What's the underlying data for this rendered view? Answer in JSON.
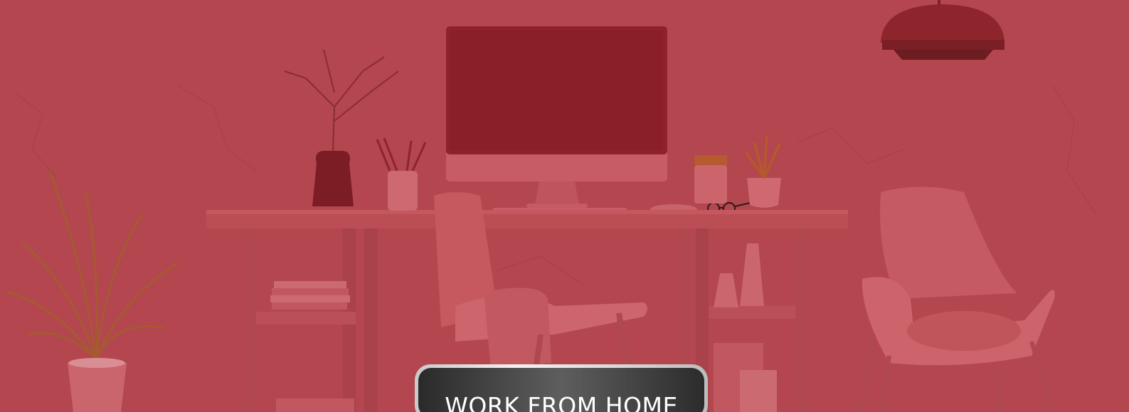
{
  "hero": {
    "overlay_color": "#b3464e",
    "badge": {
      "label": "WORK FROM HOME"
    }
  },
  "icons": [
    "monitor-icon",
    "desk-icon",
    "chair-icon",
    "armchair-icon",
    "plant-icon",
    "pendant-lamp-icon"
  ]
}
